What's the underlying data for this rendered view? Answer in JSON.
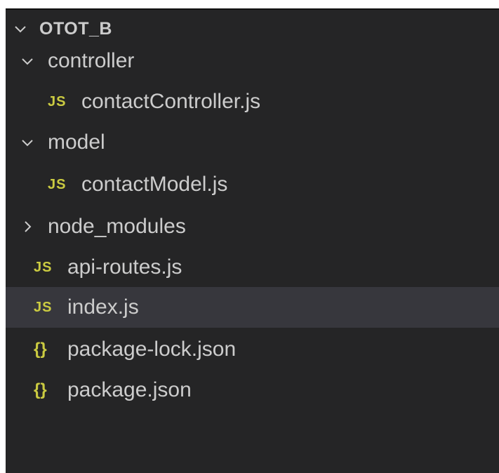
{
  "explorer": {
    "project_name": "OTOT_B",
    "folders": {
      "controller": "controller",
      "model": "model",
      "node_modules": "node_modules"
    },
    "files": {
      "contact_controller": "contactController.js",
      "contact_model": "contactModel.js",
      "api_routes": "api-routes.js",
      "index": "index.js",
      "package_lock": "package-lock.json",
      "package": "package.json"
    },
    "icons": {
      "js_badge": "JS",
      "json_badge": "{}"
    },
    "selected_file": "index.js"
  },
  "colors": {
    "background": "#252526",
    "selection": "#37373d",
    "text": "#cccccc",
    "icon_yellow": "#cbcb41"
  }
}
